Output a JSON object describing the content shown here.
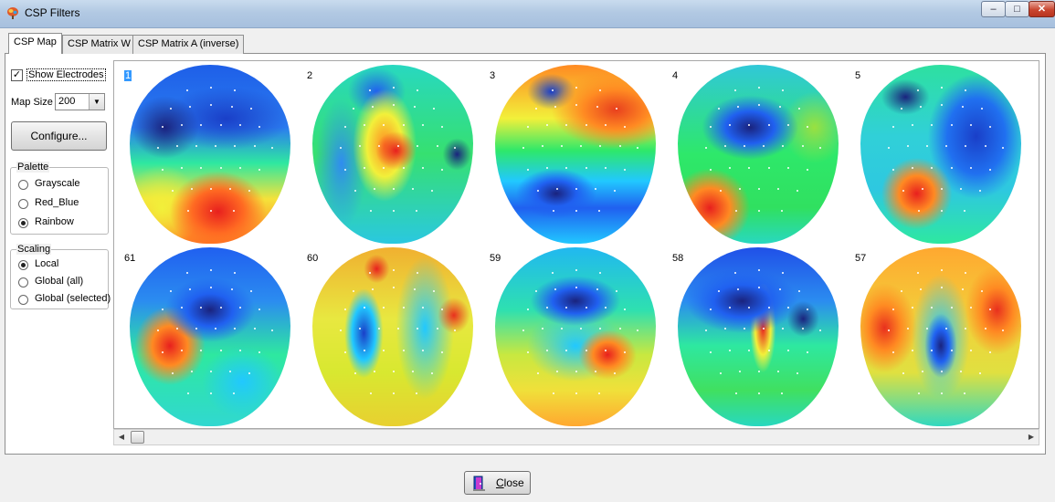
{
  "window": {
    "title": "CSP Filters",
    "controls": {
      "minimize": "–",
      "maximize": "□",
      "close": "✕"
    }
  },
  "tabs": [
    {
      "label": "CSP Map",
      "active": true
    },
    {
      "label": "CSP Matrix W",
      "active": false
    },
    {
      "label": "CSP Matrix A (inverse)",
      "active": false
    }
  ],
  "controls": {
    "show_electrodes": {
      "label": "Show Electrodes",
      "checked": true,
      "mark": "✓"
    },
    "map_size": {
      "label": "Map Size",
      "value": "200"
    },
    "configure_button": "Configure...",
    "palette": {
      "legend": "Palette",
      "options": [
        {
          "label": "Grayscale",
          "selected": false
        },
        {
          "label": "Red_Blue",
          "selected": false
        },
        {
          "label": "Rainbow",
          "selected": true
        }
      ]
    },
    "scaling": {
      "legend": "Scaling",
      "options": [
        {
          "label": "Local",
          "selected": true
        },
        {
          "label": "Global (all)",
          "selected": false
        },
        {
          "label": "Global (selected)",
          "selected": false
        }
      ]
    }
  },
  "maps": [
    {
      "label": "1",
      "selected": true,
      "palette_hint": "blue-top-red-bottom"
    },
    {
      "label": "2",
      "selected": false,
      "palette_hint": "red-center"
    },
    {
      "label": "3",
      "selected": false,
      "palette_hint": "red-top-blue-bottom"
    },
    {
      "label": "4",
      "selected": false,
      "palette_hint": "blue-top-red-left"
    },
    {
      "label": "5",
      "selected": false,
      "palette_hint": "blue-right-red-bottom"
    },
    {
      "label": "61",
      "selected": false,
      "palette_hint": "blue-top-red-left"
    },
    {
      "label": "60",
      "selected": false,
      "palette_hint": "yellow-mixed"
    },
    {
      "label": "59",
      "selected": false,
      "palette_hint": "blue-top-yellow-bottom"
    },
    {
      "label": "58",
      "selected": false,
      "palette_hint": "blue-top-green"
    },
    {
      "label": "57",
      "selected": false,
      "palette_hint": "orange-blue-center"
    }
  ],
  "footer": {
    "close_button_prefix": "",
    "close_button_underlined": "C",
    "close_button_rest": "lose"
  },
  "colors": {
    "tab_active": "#ffffff",
    "selection": "#3399ff",
    "rainbow": [
      "#1a237e",
      "#1565ff",
      "#21c8ff",
      "#2ee86a",
      "#f2f03a",
      "#ff8a22",
      "#e8201e"
    ]
  }
}
